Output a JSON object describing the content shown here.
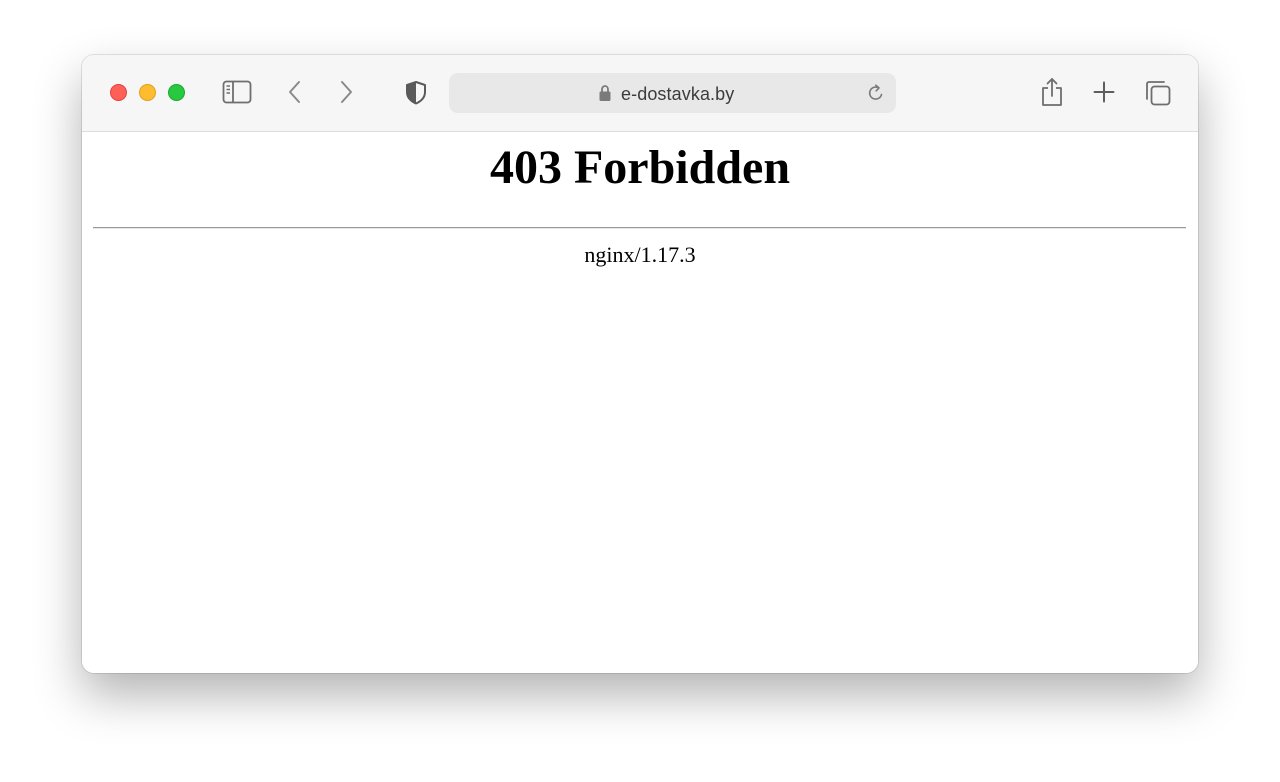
{
  "browser": {
    "url": "e-dostavka.by",
    "icons": {
      "sidebar": "sidebar-icon",
      "back": "chevron-left-icon",
      "forward": "chevron-right-icon",
      "privacy": "shield-icon",
      "lock": "lock-icon",
      "reload": "reload-icon",
      "share": "share-icon",
      "new_tab": "plus-icon",
      "tab_overview": "tabs-overview-icon"
    },
    "colors": {
      "close": "#fe5f57",
      "minimize": "#febc2e",
      "zoom": "#28c840",
      "toolbar": "#f6f6f6",
      "address_bar": "#e8e8e8"
    }
  },
  "page": {
    "heading": "403 Forbidden",
    "server": "nginx/1.17.3"
  }
}
